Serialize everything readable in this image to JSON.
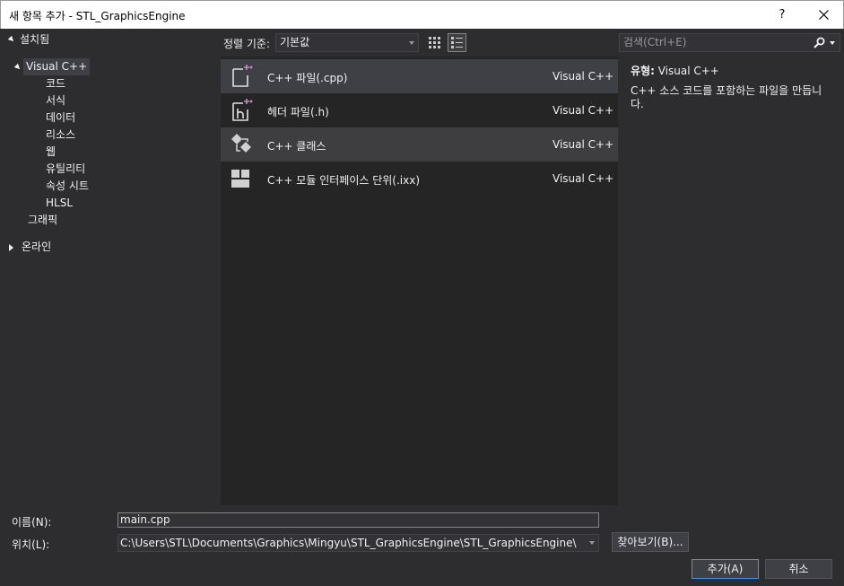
{
  "window": {
    "title": "새 항목 추가 - STL_GraphicsEngine",
    "help_label": "?"
  },
  "tree": {
    "installed": "설치됨",
    "visual_cpp": "Visual C++",
    "children": [
      "코드",
      "서식",
      "데이터",
      "리소스",
      "웹",
      "유틸리티",
      "속성 시트",
      "HLSL"
    ],
    "graphics": "그래픽",
    "online": "온라인"
  },
  "toolbar": {
    "sort_label": "정렬 기준:",
    "sort_value": "기본값",
    "search_placeholder": "검색(Ctrl+E)"
  },
  "templates": [
    {
      "name": "C++ 파일(.cpp)",
      "lang": "Visual C++"
    },
    {
      "name": "헤더 파일(.h)",
      "lang": "Visual C++"
    },
    {
      "name": "C++ 클래스",
      "lang": "Visual C++"
    },
    {
      "name": "C++ 모듈 인터페이스 단위(.ixx)",
      "lang": "Visual C++"
    }
  ],
  "info": {
    "type_label": "유형:",
    "type_value": "Visual C++",
    "description": "C++ 소스 코드를 포함하는 파일을 만듭니다."
  },
  "form": {
    "name_label": "이름(N):",
    "name_value": "main.cpp",
    "location_label": "위치(L):",
    "location_value": "C:\\Users\\STL\\Documents\\Graphics\\Mingyu\\STL_GraphicsEngine\\STL_GraphicsEngine\\",
    "browse_label": "찾아보기(B)...",
    "add_label": "추가(A)",
    "cancel_label": "취소"
  },
  "colors": {
    "accent": "#3399ff",
    "plus_purple": "#c586c0"
  }
}
